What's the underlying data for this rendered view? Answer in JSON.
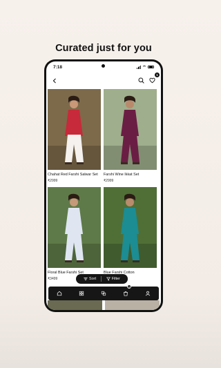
{
  "headline": "Curated just for you",
  "status_bar": {
    "time": "7:18"
  },
  "appbar": {
    "wishlist_count": "1"
  },
  "products": [
    {
      "title": "Chahat Red Farshi Salwar Set",
      "price": "₹2999",
      "colors": {
        "bg": "#7c6a4a",
        "dress": "#c72a3a",
        "pants": "#f4f1ee",
        "skin": "#c89878"
      }
    },
    {
      "title": "Farshi Wine Ikkat Set",
      "price": "₹2999",
      "colors": {
        "bg": "#9fae8c",
        "dress": "#6b1e44",
        "pants": "#6b1e44",
        "skin": "#b98a6c"
      }
    },
    {
      "title": "Floral Blue Farshi Set",
      "price": "₹3499",
      "colors": {
        "bg": "#5e7a48",
        "dress": "#dfe6f1",
        "pants": "#dfe6f1",
        "skin": "#c49a7a"
      }
    },
    {
      "title": "Blue Farshi Cotton",
      "price": "₹3499",
      "colors": {
        "bg": "#4f6f37",
        "dress": "#1b8d93",
        "pants": "#1b8d93",
        "skin": "#b88c6c"
      }
    }
  ],
  "sort_filter": {
    "sort": "Sort",
    "filter": "Filter"
  },
  "nav": {
    "cart_count": "1"
  }
}
